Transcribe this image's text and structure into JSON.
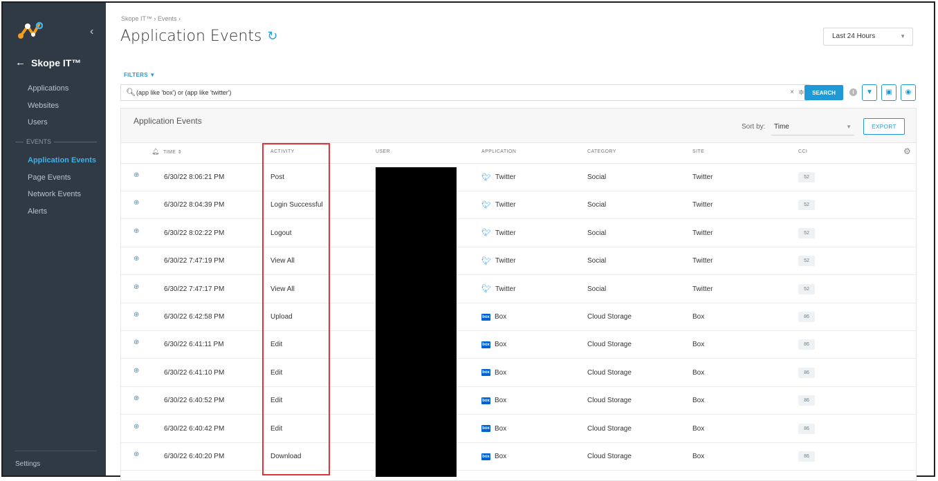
{
  "sidebar": {
    "back_label": "Skope IT™",
    "items": [
      {
        "label": "Applications"
      },
      {
        "label": "Websites"
      },
      {
        "label": "Users"
      }
    ],
    "events_section": "EVENTS",
    "event_items": [
      {
        "label": "Application Events",
        "active": true
      },
      {
        "label": "Page Events"
      },
      {
        "label": "Network Events"
      },
      {
        "label": "Alerts"
      }
    ],
    "settings_label": "Settings"
  },
  "header": {
    "breadcrumb": "Skope IT™ › Events ›",
    "title": "Application Events",
    "time_range": "Last 24 Hours"
  },
  "filters": {
    "label": "FILTERS ▼",
    "query": "(app like 'box') or (app like 'twitter')",
    "search_label": "SEARCH"
  },
  "panel": {
    "title": "Application Events",
    "sort_by_label": "Sort by:",
    "sort_by_value": "Time",
    "export_label": "EXPORT"
  },
  "columns": [
    "TIME",
    "ACTIVITY",
    "USER",
    "APPLICATION",
    "CATEGORY",
    "SITE",
    "CCI"
  ],
  "rows": [
    {
      "time": "6/30/22 8:06:21 PM",
      "activity": "Post",
      "app": "Twitter",
      "app_icon": "twitter-icon",
      "category": "Social",
      "site": "Twitter",
      "cci": "52"
    },
    {
      "time": "6/30/22 8:04:39 PM",
      "activity": "Login Successful",
      "app": "Twitter",
      "app_icon": "twitter-icon",
      "category": "Social",
      "site": "Twitter",
      "cci": "52"
    },
    {
      "time": "6/30/22 8:02:22 PM",
      "activity": "Logout",
      "app": "Twitter",
      "app_icon": "twitter-icon",
      "category": "Social",
      "site": "Twitter",
      "cci": "52"
    },
    {
      "time": "6/30/22 7:47:19 PM",
      "activity": "View All",
      "app": "Twitter",
      "app_icon": "twitter-icon",
      "category": "Social",
      "site": "Twitter",
      "cci": "52"
    },
    {
      "time": "6/30/22 7:47:17 PM",
      "activity": "View All",
      "app": "Twitter",
      "app_icon": "twitter-icon",
      "category": "Social",
      "site": "Twitter",
      "cci": "52"
    },
    {
      "time": "6/30/22 6:42:58 PM",
      "activity": "Upload",
      "app": "Box",
      "app_icon": "box-icon",
      "category": "Cloud Storage",
      "site": "Box",
      "cci": "86"
    },
    {
      "time": "6/30/22 6:41:11 PM",
      "activity": "Edit",
      "app": "Box",
      "app_icon": "box-icon",
      "category": "Cloud Storage",
      "site": "Box",
      "cci": "86"
    },
    {
      "time": "6/30/22 6:41:10 PM",
      "activity": "Edit",
      "app": "Box",
      "app_icon": "box-icon",
      "category": "Cloud Storage",
      "site": "Box",
      "cci": "86"
    },
    {
      "time": "6/30/22 6:40:52 PM",
      "activity": "Edit",
      "app": "Box",
      "app_icon": "box-icon",
      "category": "Cloud Storage",
      "site": "Box",
      "cci": "86"
    },
    {
      "time": "6/30/22 6:40:42 PM",
      "activity": "Edit",
      "app": "Box",
      "app_icon": "box-icon",
      "category": "Cloud Storage",
      "site": "Box",
      "cci": "86"
    },
    {
      "time": "6/30/22 6:40:20 PM",
      "activity": "Download",
      "app": "Box",
      "app_icon": "box-icon",
      "category": "Cloud Storage",
      "site": "Box",
      "cci": "86"
    }
  ],
  "colors": {
    "sidebar_bg": "#2f3a45",
    "accent": "#1f9ad6",
    "active_nav": "#3fb0e6",
    "highlight_box": "#e0333a",
    "twitter": "#1da1f2",
    "box": "#0061d5"
  }
}
